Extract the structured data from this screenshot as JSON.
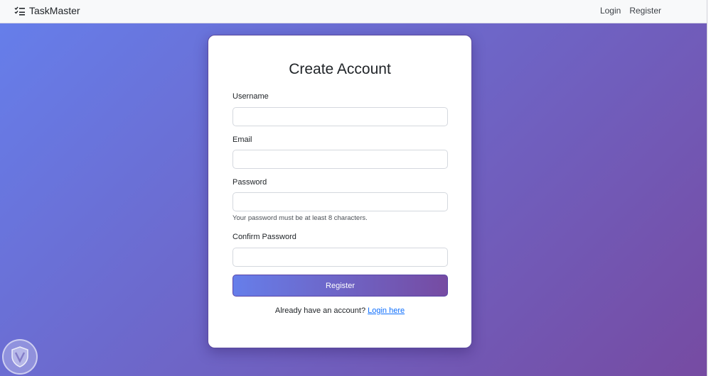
{
  "navbar": {
    "brand": "TaskMaster",
    "links": [
      "Login",
      "Register"
    ]
  },
  "form": {
    "title": "Create Account",
    "fields": [
      {
        "label": "Username",
        "value": ""
      },
      {
        "label": "Email",
        "value": ""
      },
      {
        "label": "Password",
        "value": ""
      },
      {
        "label": "Confirm Password",
        "value": ""
      }
    ],
    "password_help": "Your password must be at least 8 characters.",
    "submit_label": "Register",
    "footer_prompt": "Already have an account?",
    "footer_link": "Login here"
  },
  "colors": {
    "gradient_start": "#667eea",
    "gradient_end": "#764ba2",
    "link": "#0d6efd"
  },
  "icons": {
    "brand": "checklist-icon",
    "watermark": "shield-logo-icon"
  }
}
